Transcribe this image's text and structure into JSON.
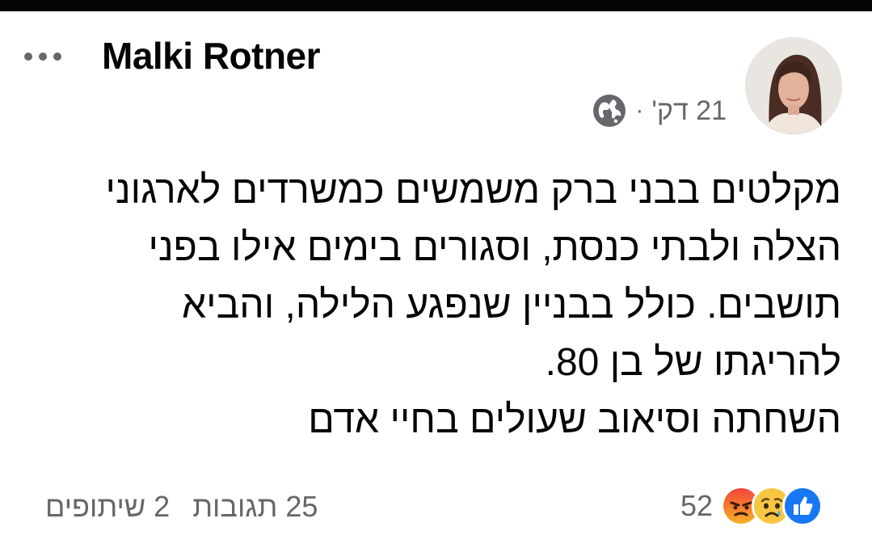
{
  "post": {
    "author_name": "Malki Rotner",
    "time": "21 דק'",
    "separator": "·",
    "privacy_icon": "globe-icon",
    "avatar": "profile-photo",
    "lines": [
      "מקלטים בבני ברק משמשים כמשרדים לארגוני",
      "הצלה ולבתי כנסת, וסגורים בימים אילו בפני",
      "תושבים. כולל בבניין שנפגע הלילה, והביא",
      "להריגתו של בן 80.",
      "השחתה וסיאוב שעולים בחיי אדם"
    ]
  },
  "footer": {
    "reaction_count": "52",
    "reaction_icons": [
      "like-icon",
      "sad-icon",
      "angry-icon"
    ],
    "comments": "25 תגובות",
    "shares": "2 שיתופים"
  },
  "colors": {
    "text_primary": "#050505",
    "text_secondary": "#65676b",
    "like_blue": "#1877f2",
    "sad_yellow": "#f7c744",
    "angry_orange": "#e9710f"
  }
}
